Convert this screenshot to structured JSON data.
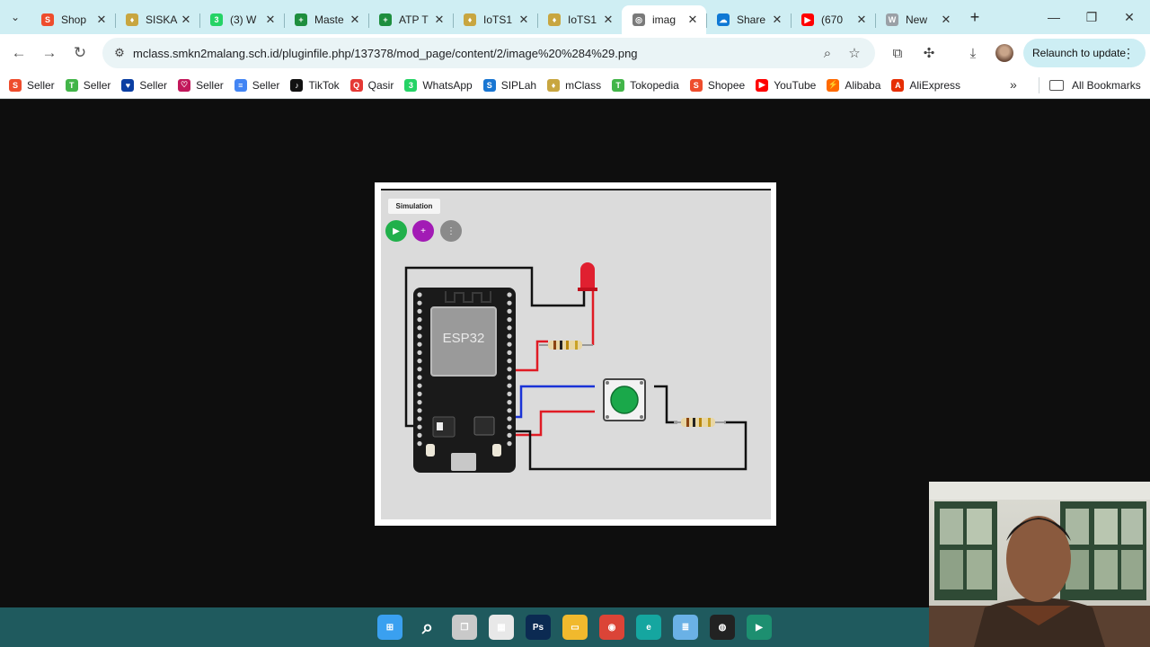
{
  "tabs": [
    {
      "title": "Shop",
      "favicon": "shopee-icon",
      "color": "#ee4d2d",
      "glyph": "S"
    },
    {
      "title": "SISKA",
      "favicon": "school-shield-icon",
      "color": "#c8a640",
      "glyph": "♦"
    },
    {
      "title": "(3) W",
      "favicon": "whatsapp-icon",
      "color": "#25d366",
      "glyph": "3"
    },
    {
      "title": "Maste",
      "favicon": "sheets-icon",
      "color": "#1e8e3e",
      "glyph": "+"
    },
    {
      "title": "ATP T",
      "favicon": "sheets-icon",
      "color": "#1e8e3e",
      "glyph": "+"
    },
    {
      "title": "IoTS1",
      "favicon": "school-shield-icon",
      "color": "#c8a640",
      "glyph": "♦"
    },
    {
      "title": "IoTS1",
      "favicon": "school-shield-icon",
      "color": "#c8a640",
      "glyph": "♦"
    },
    {
      "title": "imag",
      "favicon": "globe-icon",
      "color": "#7a7a7a",
      "glyph": "◎"
    },
    {
      "title": "Share",
      "favicon": "onedrive-icon",
      "color": "#0f78d4",
      "glyph": "☁"
    },
    {
      "title": "(670",
      "favicon": "youtube-icon",
      "color": "#ff0000",
      "glyph": "▶"
    },
    {
      "title": "New",
      "favicon": "w-icon",
      "color": "#9aa0a6",
      "glyph": "W"
    }
  ],
  "address": {
    "url": "mclass.smkn2malang.sch.id/pluginfile.php/137378/mod_page/content/2/image%20%284%29.png"
  },
  "relaunch_label": "Relaunch to update",
  "bookmarks": [
    {
      "label": "Seller",
      "icon": "shopee-icon",
      "color": "#ee4d2d",
      "glyph": "S"
    },
    {
      "label": "Seller",
      "icon": "tokopedia-icon",
      "color": "#42b549",
      "glyph": "T"
    },
    {
      "label": "Seller",
      "icon": "blibli-icon",
      "color": "#0a3ea3",
      "glyph": "♥"
    },
    {
      "label": "Seller",
      "icon": "lazada-icon",
      "color": "#c2185b",
      "glyph": "♡"
    },
    {
      "label": "Seller",
      "icon": "docs-icon",
      "color": "#4285f4",
      "glyph": "≡"
    },
    {
      "label": "TikTok",
      "icon": "tiktok-icon",
      "color": "#111111",
      "glyph": "♪"
    },
    {
      "label": "Qasir",
      "icon": "qasir-icon",
      "color": "#e53935",
      "glyph": "Q"
    },
    {
      "label": "WhatsApp",
      "icon": "whatsapp-icon",
      "color": "#25d366",
      "glyph": "3"
    },
    {
      "label": "SIPLah",
      "icon": "siplah-icon",
      "color": "#1976d2",
      "glyph": "S"
    },
    {
      "label": "mClass",
      "icon": "school-shield-icon",
      "color": "#c8a640",
      "glyph": "♦"
    },
    {
      "label": "Tokopedia",
      "icon": "tokopedia-icon",
      "color": "#42b549",
      "glyph": "T"
    },
    {
      "label": "Shopee",
      "icon": "shopee-icon",
      "color": "#ee4d2d",
      "glyph": "S"
    },
    {
      "label": "YouTube",
      "icon": "youtube-icon",
      "color": "#ff0000",
      "glyph": "▶"
    },
    {
      "label": "Alibaba",
      "icon": "alibaba-icon",
      "color": "#ff6a00",
      "glyph": "⚡"
    },
    {
      "label": "AliExpress",
      "icon": "aliexpress-icon",
      "color": "#e62e04",
      "glyph": "A"
    }
  ],
  "all_bookmarks_label": "All Bookmarks",
  "simulation": {
    "tab_label": "Simulation",
    "chip_label": "ESP32"
  },
  "taskbar": [
    {
      "icon": "windows-start-icon",
      "color": "#3aa0f0",
      "glyph": "⊞"
    },
    {
      "icon": "search-icon",
      "color": "transparent",
      "glyph": "⌕"
    },
    {
      "icon": "task-view-icon",
      "color": "#c9c9c9",
      "glyph": "❐"
    },
    {
      "icon": "widgets-icon",
      "color": "#e8e8e8",
      "glyph": "▦"
    },
    {
      "icon": "photoshop-icon",
      "color": "#0b2a52",
      "glyph": "Ps"
    },
    {
      "icon": "file-explorer-icon",
      "color": "#f1b92d",
      "glyph": "▭"
    },
    {
      "icon": "chrome-icon",
      "color": "#db4437",
      "glyph": "◉"
    },
    {
      "icon": "edge-icon",
      "color": "#15a6a0",
      "glyph": "e"
    },
    {
      "icon": "notepad-icon",
      "color": "#6ab1e6",
      "glyph": "≣"
    },
    {
      "icon": "obs-icon",
      "color": "#222222",
      "glyph": "◍"
    },
    {
      "icon": "media-app-icon",
      "color": "#1d8f70",
      "glyph": "▶"
    }
  ],
  "colors": {
    "tabstrip": "#cfeef3",
    "relaunch": "#cdeef4",
    "viewer_bg": "#0e0e0e",
    "taskbar": "#1f5a5e",
    "wire_red": "#e01b24",
    "wire_blue": "#1a33d6",
    "button_green": "#1aa84a",
    "led_red": "#e02030"
  }
}
